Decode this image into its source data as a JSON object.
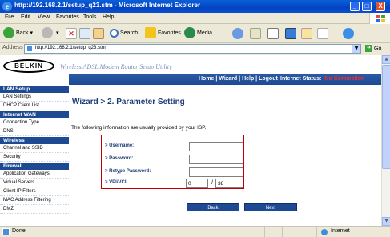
{
  "window": {
    "title": "http://192.168.2.1/setup_q23.stm - Microsoft Internet Explorer",
    "controls": [
      "_",
      "□",
      "X"
    ]
  },
  "menu": [
    "File",
    "Edit",
    "View",
    "Favorites",
    "Tools",
    "Help"
  ],
  "toolbar": {
    "back": "Back",
    "search": "Search",
    "favorites": "Favorites",
    "media": "Media"
  },
  "address": {
    "label": "Address",
    "url": "http://192.168.2.1/setup_q23.stm",
    "go": "Go"
  },
  "banner": {
    "logo": "BELKIN",
    "utility_title": "Wireless ADSL Modem Router Setup Utility"
  },
  "nav": {
    "links": [
      "Home",
      "Wizard",
      "Help",
      "Logout"
    ],
    "status_label": "Internet Status:",
    "status_value": "No Connection"
  },
  "sidebar": [
    {
      "heading": "LAN Setup",
      "items": [
        "LAN Settings",
        "DHCP Client List"
      ]
    },
    {
      "heading": "Internet WAN",
      "items": [
        "Connection Type",
        "DNS"
      ]
    },
    {
      "heading": "Wireless",
      "items": [
        "Channel and SSID",
        "Security"
      ]
    },
    {
      "heading": "Firewall",
      "items": [
        "Application Gateways",
        "Virtual Servers",
        "Client IP Filters",
        "MAC Address Filtering",
        "DMZ"
      ]
    }
  ],
  "page": {
    "heading": "Wizard > 2. Parameter Setting",
    "intro": "The following information are usually provided by your ISP.",
    "fields": {
      "username_label": "> Username:",
      "username_value": "",
      "password_label": "> Password:",
      "password_value": "",
      "retype_label": "> Retype Password:",
      "retype_value": "",
      "vpivci_label": "> VPI/VCI:",
      "vpi_value": "0",
      "slash": "/",
      "vci_value": "38"
    },
    "buttons": {
      "back": "Back",
      "next": "Next"
    }
  },
  "statusbar": {
    "text": "Done",
    "zone": "Internet"
  },
  "colors": {
    "nav_blue": "#1e4a94",
    "heading_blue": "#1e3c78",
    "alert_red": "#ff2a2a",
    "form_border": "#c00000"
  }
}
